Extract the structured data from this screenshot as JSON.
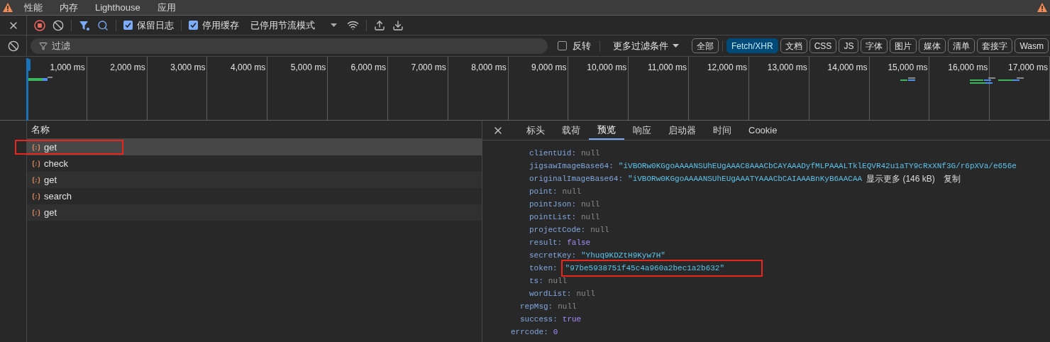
{
  "panel_tabs": [
    {
      "label": "性能",
      "selected": false
    },
    {
      "label": "内存",
      "selected": false
    },
    {
      "label": "Lighthouse",
      "selected": false
    },
    {
      "label": "应用",
      "selected": false
    }
  ],
  "toolbar": {
    "preserve_log": {
      "label": "保留日志",
      "checked": true
    },
    "disable_cache": {
      "label": "停用缓存",
      "checked": true
    },
    "throttling": "已停用节流模式"
  },
  "filter": {
    "placeholder": "过滤",
    "invert": {
      "label": "反转",
      "checked": false
    },
    "more_filters": "更多过滤条件",
    "types": [
      {
        "label": "全部",
        "selected": false
      },
      {
        "label": "Fetch/XHR",
        "selected": true
      },
      {
        "label": "文档",
        "selected": false
      },
      {
        "label": "CSS",
        "selected": false
      },
      {
        "label": "JS",
        "selected": false
      },
      {
        "label": "字体",
        "selected": false
      },
      {
        "label": "图片",
        "selected": false
      },
      {
        "label": "媒体",
        "selected": false
      },
      {
        "label": "清单",
        "selected": false
      },
      {
        "label": "套接字",
        "selected": false
      },
      {
        "label": "Wasm",
        "selected": false
      }
    ]
  },
  "timeline": {
    "ticks": [
      "1,000 ms",
      "2,000 ms",
      "3,000 ms",
      "4,000 ms",
      "5,000 ms",
      "6,000 ms",
      "7,000 ms",
      "8,000 ms",
      "9,000 ms",
      "10,000 ms",
      "11,000 ms",
      "12,000 ms",
      "13,000 ms",
      "14,000 ms",
      "15,000 ms",
      "16,000 ms",
      "17,000 ms"
    ]
  },
  "requests": {
    "column": "名称",
    "rows": [
      {
        "name": "get",
        "selected": true,
        "highlighted": true
      },
      {
        "name": "check",
        "selected": false,
        "highlighted": false
      },
      {
        "name": "get",
        "selected": false,
        "highlighted": false
      },
      {
        "name": "search",
        "selected": false,
        "highlighted": false
      },
      {
        "name": "get",
        "selected": false,
        "highlighted": false
      }
    ]
  },
  "detail": {
    "tabs": [
      {
        "label": "标头",
        "selected": false
      },
      {
        "label": "载荷",
        "selected": false
      },
      {
        "label": "预览",
        "selected": true
      },
      {
        "label": "响应",
        "selected": false
      },
      {
        "label": "启动器",
        "selected": false
      },
      {
        "label": "时间",
        "selected": false
      },
      {
        "label": "Cookie",
        "selected": false
      }
    ],
    "tree": [
      {
        "children": [
          {
            "children": [
              {
                "key": "clientUid:",
                "value": "null",
                "kind": "null"
              },
              {
                "key": "jigsawImageBase64:",
                "value": "\"iVBORw0KGgoAAAANSUhEUgAAAC8AAACbCAYAAADyfMLPAAALTklEQVR42u1aTY9cRxXNf3G/r6pXVa/e656e",
                "kind": "string"
              },
              {
                "key": "originalImageBase64:",
                "value": "\"iVBORw0KGgoAAAANSUhEUgAAATYAAACbCAIAAABnKyB6AACAA",
                "kind": "string",
                "more": "显示更多 (146 kB)",
                "copy": "复制"
              },
              {
                "key": "point:",
                "value": "null",
                "kind": "null"
              },
              {
                "key": "pointJson:",
                "value": "null",
                "kind": "null"
              },
              {
                "key": "pointList:",
                "value": "null",
                "kind": "null"
              },
              {
                "key": "projectCode:",
                "value": "null",
                "kind": "null"
              },
              {
                "key": "result:",
                "value": "false",
                "kind": "literal"
              },
              {
                "key": "secretKey:",
                "value": "\"Yhuq9KDZtH9Kyw7H\"",
                "kind": "string"
              },
              {
                "key": "token:",
                "value": "\"97be5938751f45c4a960a2bec1a2b632\"",
                "kind": "string",
                "highlighted": true
              },
              {
                "key": "ts:",
                "value": "null",
                "kind": "null"
              },
              {
                "key": "wordList:",
                "value": "null",
                "kind": "null"
              }
            ]
          },
          {
            "key": "repMsg:",
            "value": "null",
            "kind": "null"
          },
          {
            "key": "success:",
            "value": "true",
            "kind": "literal"
          }
        ]
      },
      {
        "key": "errcode:",
        "value": "0",
        "kind": "literal"
      }
    ]
  }
}
